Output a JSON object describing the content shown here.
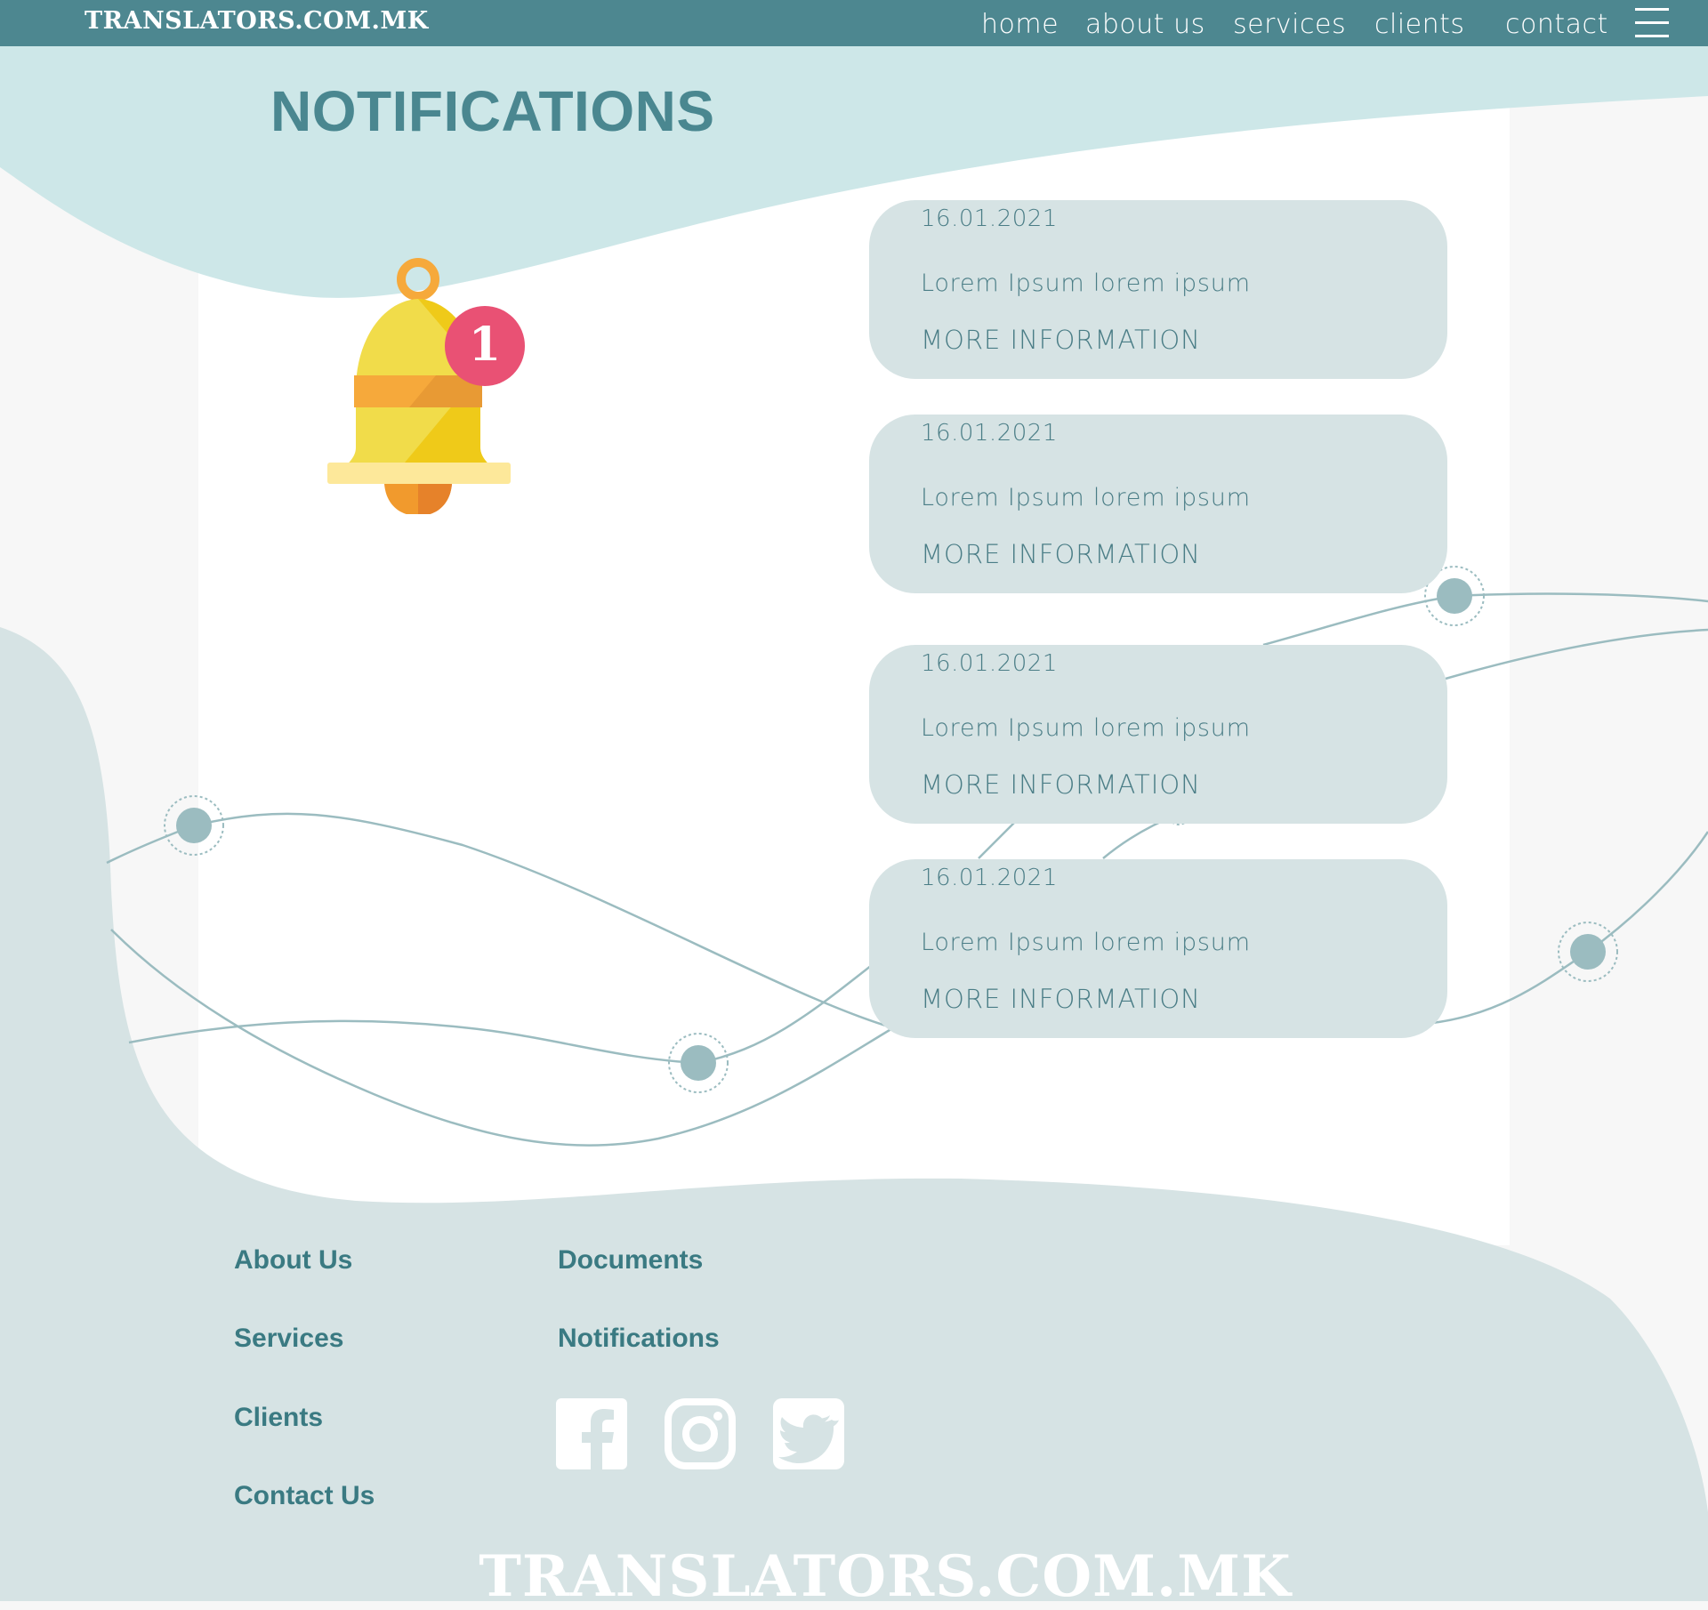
{
  "header": {
    "brand": "TRANSLATORS.COM.MK",
    "nav": [
      {
        "label": "home"
      },
      {
        "label": "about us"
      },
      {
        "label": "services"
      },
      {
        "label": "clients"
      },
      {
        "label": "contact"
      }
    ],
    "menu_icon": "hamburger-menu-icon"
  },
  "page": {
    "title": "NOTIFICATIONS"
  },
  "bell": {
    "icon": "bell-icon",
    "badge_count": "1"
  },
  "notifications": [
    {
      "date": "16.01.2021",
      "text": "Lorem Ipsum lorem ipsum",
      "link": "MORE INFORMATION"
    },
    {
      "date": "16.01.2021",
      "text": "Lorem Ipsum lorem ipsum",
      "link": "MORE INFORMATION"
    },
    {
      "date": "16.01.2021",
      "text": "Lorem Ipsum lorem ipsum",
      "link": "MORE INFORMATION"
    },
    {
      "date": "16.01.2021",
      "text": "Lorem Ipsum lorem ipsum",
      "link": "MORE INFORMATION"
    }
  ],
  "footer": {
    "links_col1": [
      {
        "label": "About Us"
      },
      {
        "label": "Services"
      },
      {
        "label": "Clients"
      },
      {
        "label": "Contact Us"
      }
    ],
    "links_col2": [
      {
        "label": "Documents"
      },
      {
        "label": "Notifications"
      }
    ],
    "social": [
      "facebook-icon",
      "instagram-icon",
      "twitter-icon"
    ],
    "brand": "TRANSLATORS.COM.MK"
  },
  "colors": {
    "header_bg": "#4d8790",
    "top_wave": "#cde7e8",
    "card_bg": "#d6e3e4",
    "footer_bg": "#d6e3e4",
    "accent_text": "#4a8790",
    "badge": "#e95174",
    "bell": "#f1dc4a"
  }
}
